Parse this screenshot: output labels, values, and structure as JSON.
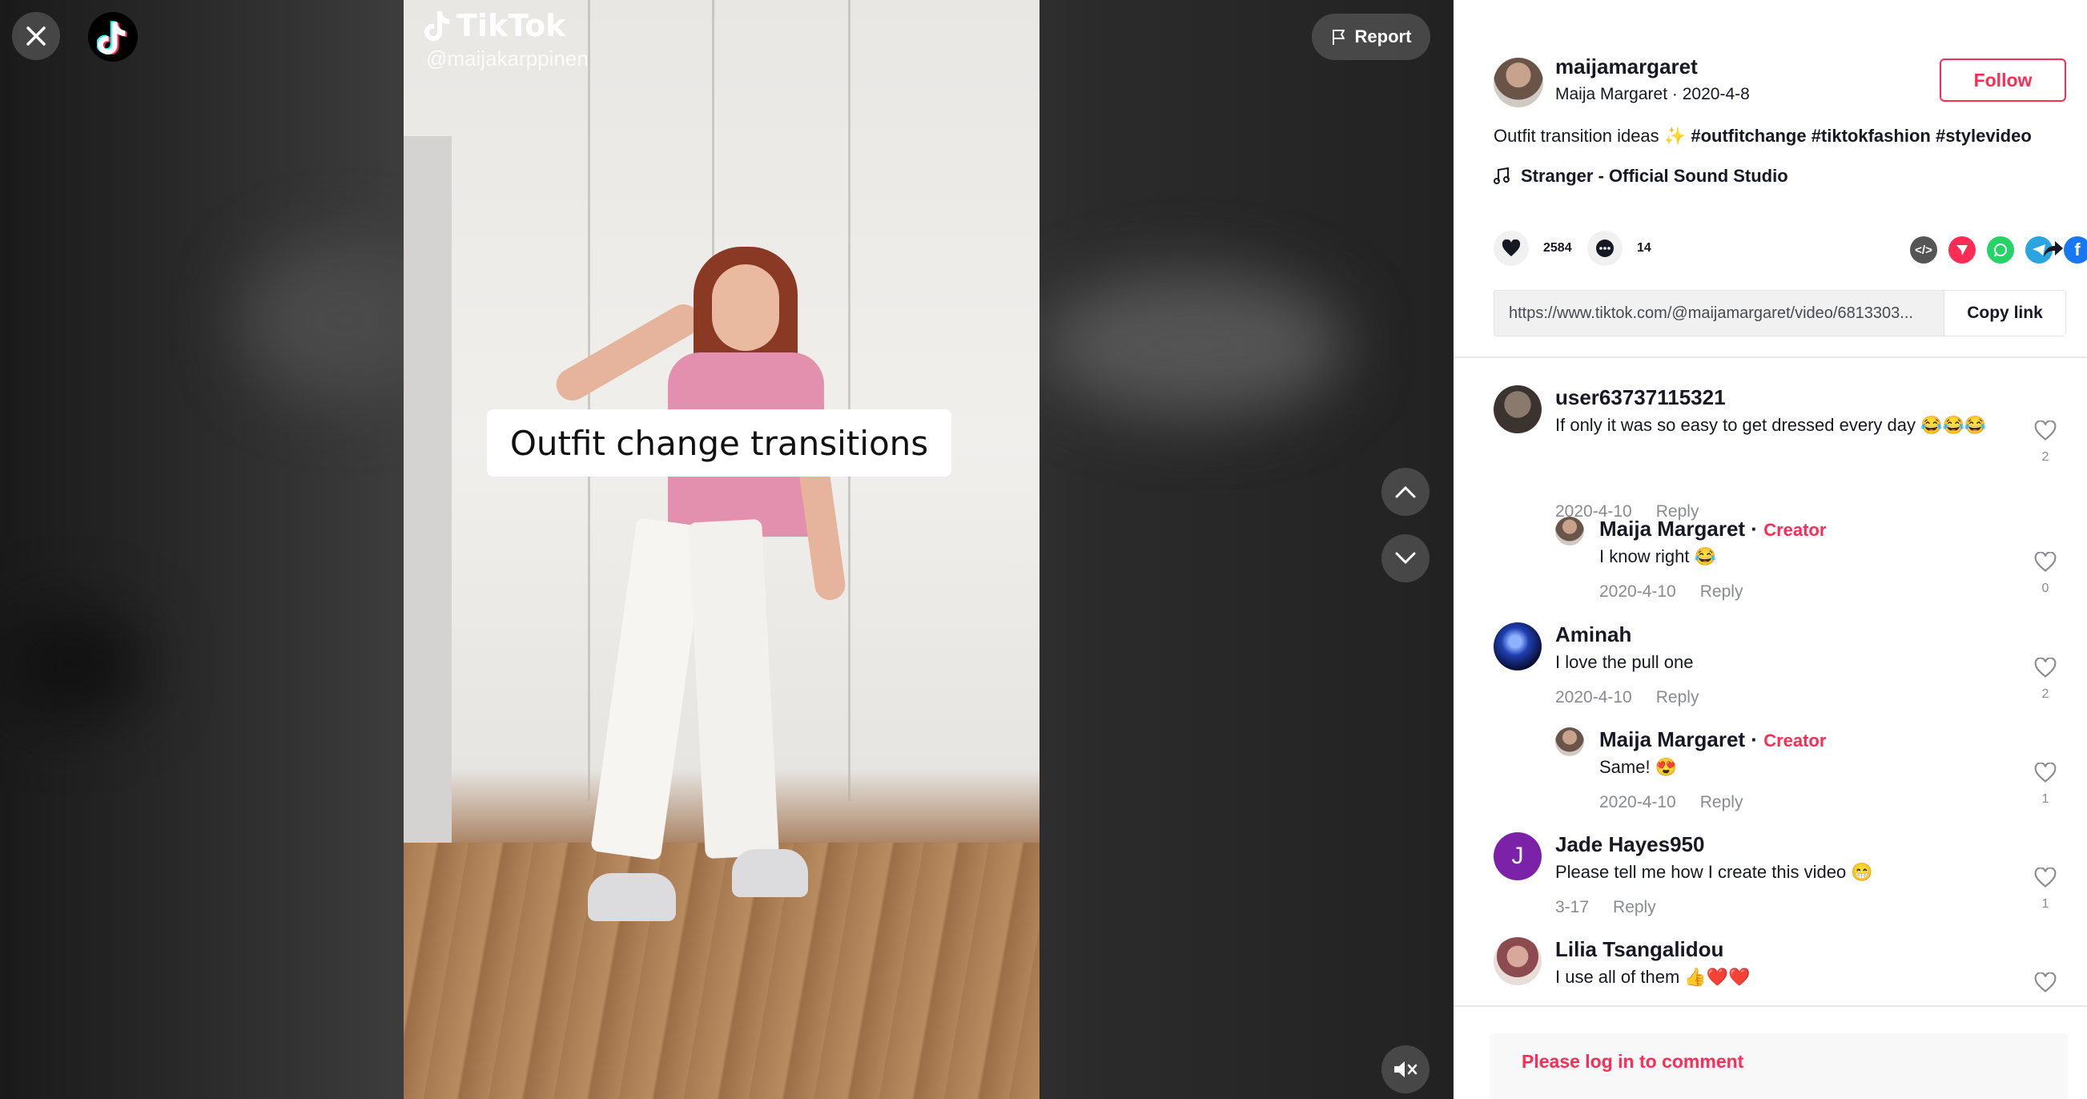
{
  "overlay": {
    "report_label": "Report"
  },
  "video": {
    "watermark_brand": "TikTok",
    "watermark_handle": "@maijakarppinen",
    "caption": "Outfit change transitions"
  },
  "author": {
    "username": "maijamargaret",
    "display_name": "Maija Margaret",
    "date": "2020-4-8",
    "follow_label": "Follow"
  },
  "post": {
    "description": "Outfit transition ideas",
    "hashtags": [
      "#outfitchange",
      "#tiktokfashion",
      "#stylevideo"
    ],
    "music": "Stranger - Official Sound Studio"
  },
  "stats": {
    "likes": "2584",
    "comments": "14"
  },
  "share": {
    "icons": [
      "embed-icon",
      "send-icon",
      "whatsapp-icon",
      "telegram-icon",
      "facebook-icon",
      "share-arrow-icon"
    ],
    "link": "https://www.tiktok.com/@maijamargaret/video/6813303...",
    "copy_label": "Copy link"
  },
  "comments": [
    {
      "user": "user63737115321",
      "text": "If only it was so easy to get dressed every day 😂😂😂",
      "date": "2020-4-10",
      "reply": "Reply",
      "likes": "2"
    },
    {
      "user": "Maija Margaret",
      "creator": "Creator",
      "text": "I know right 😂",
      "date": "2020-4-10",
      "reply": "Reply",
      "likes": "0"
    },
    {
      "user": "Aminah",
      "text": "I love the pull one",
      "date": "2020-4-10",
      "reply": "Reply",
      "likes": "2"
    },
    {
      "user": "Maija Margaret",
      "creator": "Creator",
      "text": "Same! 😍",
      "date": "2020-4-10",
      "reply": "Reply",
      "likes": "1"
    },
    {
      "user": "Jade Hayes950",
      "avatar_letter": "J",
      "text": "Please tell me how I create this video 😁",
      "date": "3-17",
      "reply": "Reply",
      "likes": "1"
    },
    {
      "user": "Lilia Tsangalidou",
      "text": "I use all of them 👍❤️❤️",
      "date": "",
      "reply": "",
      "likes": ""
    }
  ],
  "login_prompt": "Please log in to comment",
  "colors": {
    "accent": "#fe2c55",
    "text": "#161823",
    "muted": "#8a8b91"
  }
}
